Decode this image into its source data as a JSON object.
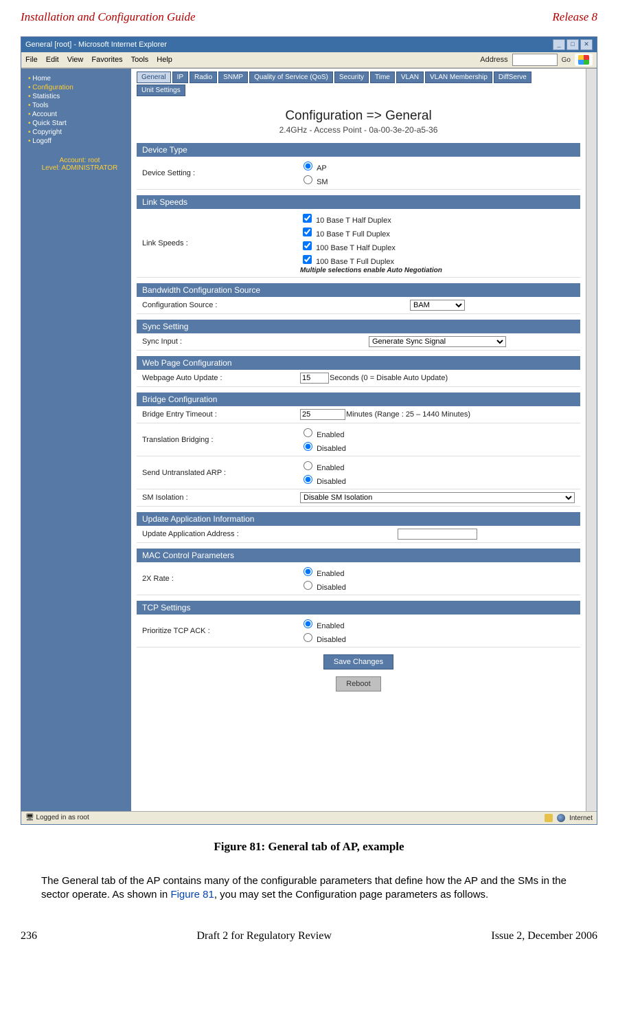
{
  "doc": {
    "header_left": "Installation and Configuration Guide",
    "header_right": "Release 8",
    "page_number": "236",
    "footer_center": "Draft 2 for Regulatory Review",
    "footer_right": "Issue 2, December 2006",
    "figure_caption": "Figure 81: General tab of AP, example",
    "body_text_1": "The General tab of the AP contains many of the configurable parameters that define how the AP and the SMs in the sector operate. As shown in ",
    "body_text_figref": "Figure 81",
    "body_text_2": ", you may set the Configuration page parameters as follows."
  },
  "browser": {
    "title": "General [root] - Microsoft Internet Explorer",
    "menus": [
      "File",
      "Edit",
      "View",
      "Favorites",
      "Tools",
      "Help"
    ],
    "address_label": "Address",
    "go_label": "Go",
    "status_left": "Logged in as root",
    "status_right": "Internet"
  },
  "sidebar": {
    "items": [
      {
        "label": "Home"
      },
      {
        "label": "Configuration",
        "active": true
      },
      {
        "label": "Statistics"
      },
      {
        "label": "Tools"
      },
      {
        "label": "Account"
      },
      {
        "label": "Quick Start"
      },
      {
        "label": "Copyright"
      },
      {
        "label": "Logoff"
      }
    ],
    "account_line1": "Account: root",
    "account_line2": "Level: ADMINISTRATOR"
  },
  "tabs": [
    "General",
    "IP",
    "Radio",
    "SNMP",
    "Quality of Service (QoS)",
    "Security",
    "Time",
    "VLAN",
    "VLAN Membership",
    "DiffServe",
    "Unit Settings"
  ],
  "page_title": "Configuration => General",
  "page_subtitle": "2.4GHz - Access Point - 0a-00-3e-20-a5-36",
  "sections": {
    "device_type": {
      "header": "Device Type",
      "label": "Device Setting :",
      "opt_ap": "AP",
      "opt_sm": "SM"
    },
    "link_speeds": {
      "header": "Link Speeds",
      "label": "Link Speeds :",
      "opts": [
        "10 Base T Half Duplex",
        "10 Base T Full Duplex",
        "100 Base T Half Duplex",
        "100 Base T Full Duplex"
      ],
      "note": "Multiple selections enable Auto Negotiation"
    },
    "bw_config": {
      "header": "Bandwidth Configuration Source",
      "label": "Configuration Source :",
      "value": "BAM"
    },
    "sync": {
      "header": "Sync Setting",
      "label": "Sync Input :",
      "value": "Generate Sync Signal"
    },
    "webpage": {
      "header": "Web Page Configuration",
      "label": "Webpage Auto Update :",
      "value": "15",
      "suffix": "Seconds (0 = Disable Auto Update)"
    },
    "bridge": {
      "header": "Bridge Configuration",
      "entry_label": "Bridge Entry Timeout :",
      "entry_value": "25",
      "entry_suffix": "Minutes (Range : 25 – 1440 Minutes)",
      "trans_label": "Translation Bridging :",
      "arp_label": "Send Untranslated ARP :",
      "iso_label": "SM Isolation :",
      "iso_value": "Disable SM Isolation",
      "enabled": "Enabled",
      "disabled": "Disabled"
    },
    "update": {
      "header": "Update Application Information",
      "label": "Update Application Address :",
      "value": ""
    },
    "mac": {
      "header": "MAC Control Parameters",
      "label": "2X Rate :",
      "enabled": "Enabled",
      "disabled": "Disabled"
    },
    "tcp": {
      "header": "TCP Settings",
      "label": "Prioritize TCP ACK :",
      "enabled": "Enabled",
      "disabled": "Disabled"
    }
  },
  "buttons": {
    "save": "Save Changes",
    "reboot": "Reboot"
  }
}
